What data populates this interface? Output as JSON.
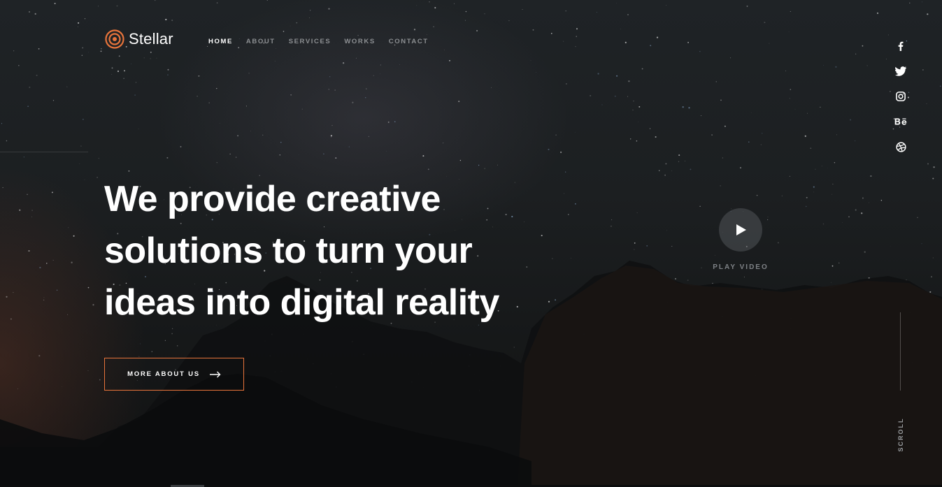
{
  "brand": {
    "name": "Stellar",
    "accent": "#e8743b"
  },
  "nav": {
    "items": [
      {
        "label": "HOME",
        "active": true
      },
      {
        "label": "ABOUT",
        "active": false
      },
      {
        "label": "SERVICES",
        "active": false
      },
      {
        "label": "WORKS",
        "active": false
      },
      {
        "label": "CONTACT",
        "active": false
      }
    ]
  },
  "social": {
    "icons": [
      "facebook-icon",
      "twitter-icon",
      "instagram-icon",
      "behance-icon",
      "dribbble-icon"
    ]
  },
  "hero": {
    "headline_lines": [
      "We provide creative",
      "solutions to turn your",
      "ideas into digital reality"
    ],
    "cta_label": "MORE ABOUT US",
    "play_label": "PLAY VIDEO",
    "scroll_label": "SCROLL"
  }
}
